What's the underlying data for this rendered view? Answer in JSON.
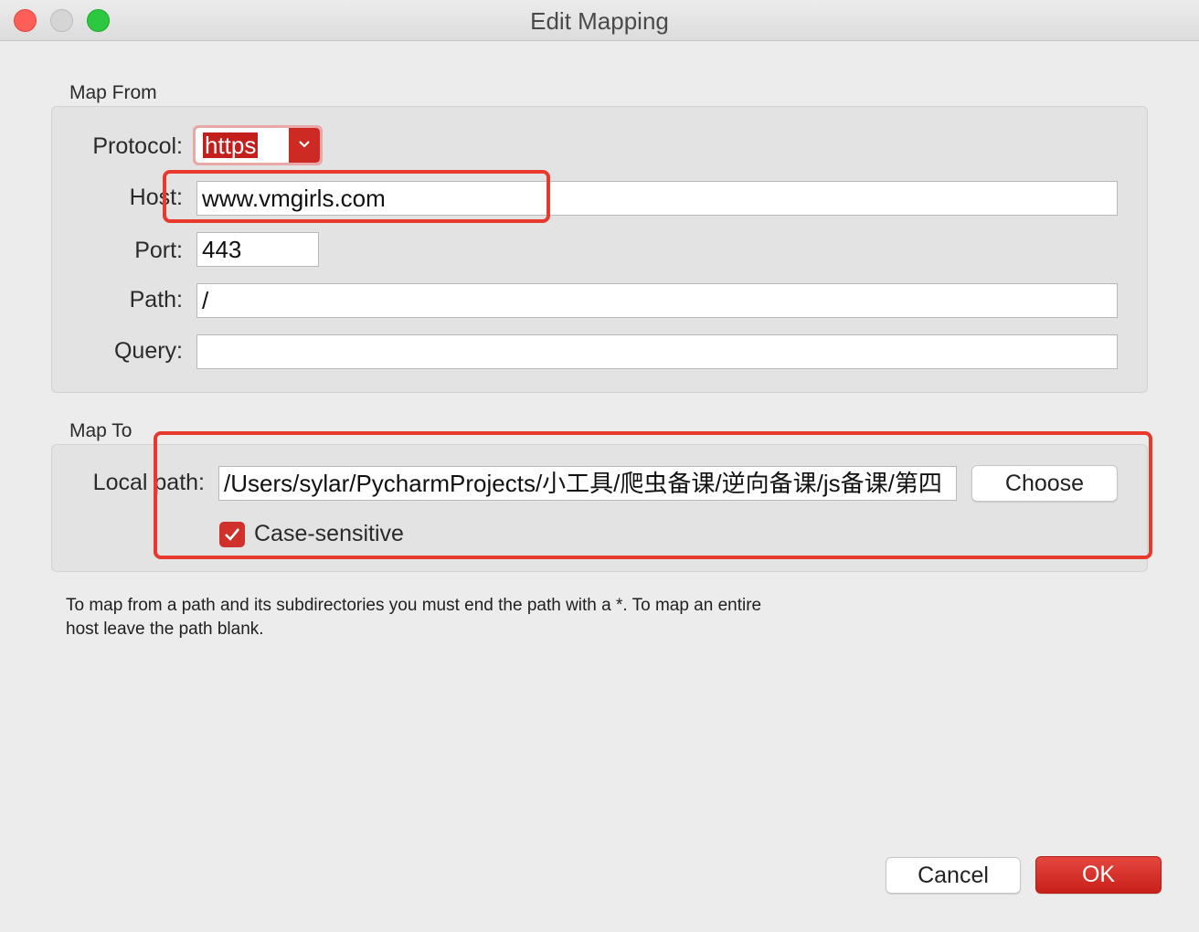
{
  "window": {
    "title": "Edit Mapping"
  },
  "map_from": {
    "section_label": "Map From",
    "protocol_label": "Protocol:",
    "protocol_value": "https",
    "host_label": "Host:",
    "host_value": "www.vmgirls.com",
    "port_label": "Port:",
    "port_value": "443",
    "path_label": "Path:",
    "path_value": "/",
    "query_label": "Query:",
    "query_value": ""
  },
  "map_to": {
    "section_label": "Map To",
    "local_path_label": "Local path:",
    "local_path_value": "/Users/sylar/PycharmProjects/小工具/爬虫备课/逆向备课/js备课/第四",
    "choose_label": "Choose",
    "case_sensitive_label": "Case-sensitive",
    "case_sensitive_checked": true
  },
  "help_text": "To map from a path and its subdirectories you must end the path with a *. To map an entire host leave the path blank.",
  "buttons": {
    "cancel": "Cancel",
    "ok": "OK"
  },
  "colors": {
    "accent": "#c9201a",
    "annotation": "#e8392f"
  }
}
